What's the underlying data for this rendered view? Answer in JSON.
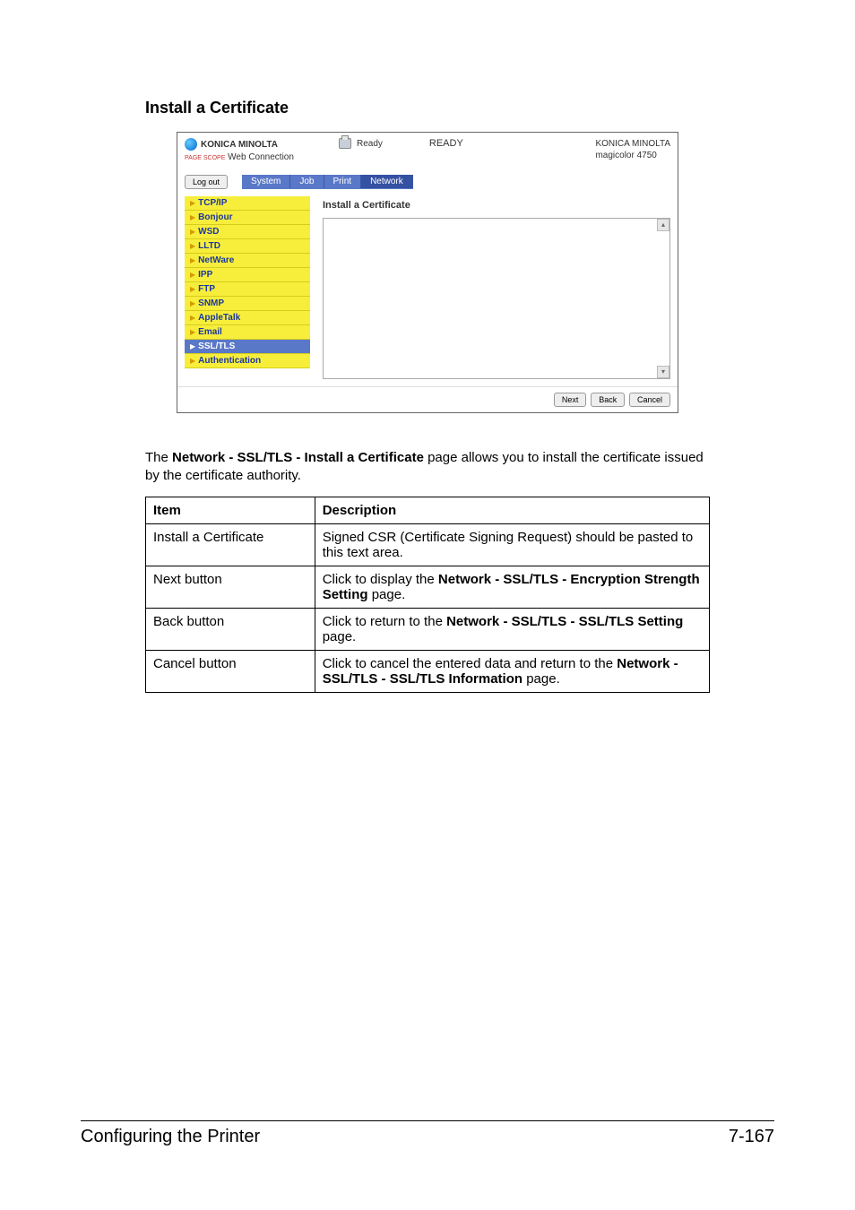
{
  "section_heading": "Install a Certificate",
  "body_paragraph_prefix": "The ",
  "body_paragraph_bold": "Network - SSL/TLS - Install a Certificate",
  "body_paragraph_suffix": " page allows you to install the certificate issued by the certificate authority.",
  "screenshot": {
    "brand_line1": "KONICA MINOLTA",
    "brand_line2_prefix": "PAGE SCOPE",
    "brand_line2": " Web Connection",
    "status_small": "Ready",
    "status_big": "READY",
    "model_line1": "KONICA MINOLTA",
    "model_line2": "magicolor 4750",
    "logout": "Log out",
    "tabs": [
      "System",
      "Job",
      "Print",
      "Network"
    ],
    "active_tab_index": 3,
    "sidebar": [
      "TCP/IP",
      "Bonjour",
      "WSD",
      "LLTD",
      "NetWare",
      "IPP",
      "FTP",
      "SNMP",
      "AppleTalk",
      "Email",
      "SSL/TLS",
      "Authentication"
    ],
    "selected_sidebar_index": 10,
    "content_title": "Install a Certificate",
    "buttons": {
      "next": "Next",
      "back": "Back",
      "cancel": "Cancel"
    }
  },
  "table": {
    "headers": [
      "Item",
      "Description"
    ],
    "rows": [
      {
        "item": "Install a Certificate",
        "desc_plain": "Signed CSR (Certificate Signing Request) should be pasted to this text area."
      },
      {
        "item": "Next button",
        "desc_prefix": "Click to display the ",
        "desc_bold": "Network - SSL/TLS - Encryption Strength Setting",
        "desc_suffix": " page."
      },
      {
        "item": "Back button",
        "desc_prefix": "Click to return to the ",
        "desc_bold": "Network - SSL/TLS - SSL/TLS Setting",
        "desc_suffix": " page."
      },
      {
        "item": "Cancel button",
        "desc_prefix": "Click to cancel the entered data and return to the ",
        "desc_bold": "Network - SSL/TLS - SSL/TLS Information",
        "desc_suffix": " page."
      }
    ]
  },
  "footer": {
    "left": "Configuring the Printer",
    "right": "7-167"
  }
}
